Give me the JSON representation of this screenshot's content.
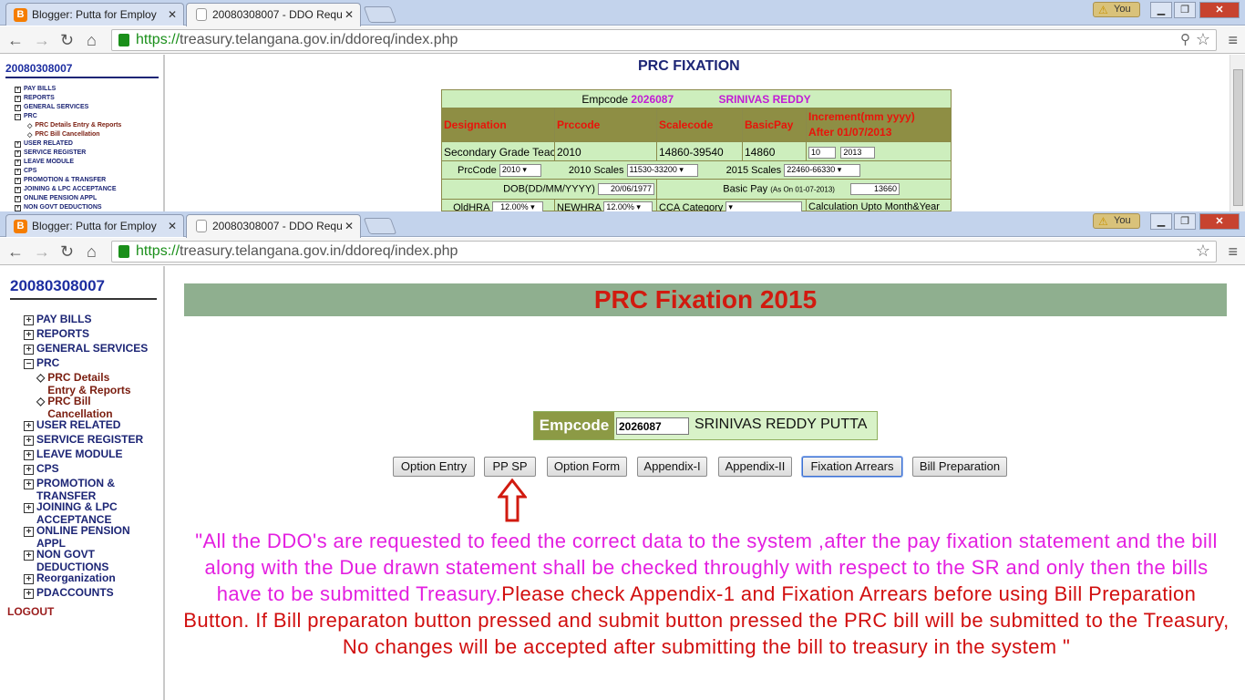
{
  "windows": [
    {
      "tabs": [
        {
          "label": "Blogger: Putta for Employ",
          "icon": "blogger-icon",
          "active": false
        },
        {
          "label": "20080308007 - DDO Requ",
          "icon": "page-icon",
          "active": true
        }
      ],
      "profile_badge": "You",
      "url_scheme": "https://",
      "url_rest": "treasury.telangana.gov.in/ddoreq/index.php",
      "sidebar": {
        "ddo_code": "20080308007",
        "items": [
          {
            "label": "PAY BILLS"
          },
          {
            "label": "REPORTS"
          },
          {
            "label": "GENERAL SERVICES"
          },
          {
            "label": "PRC"
          },
          {
            "label": "PRC Details Entry & Reports"
          },
          {
            "label": "PRC Bill Cancellation"
          },
          {
            "label": "USER RELATED"
          },
          {
            "label": "SERVICE REGISTER"
          },
          {
            "label": "LEAVE MODULE"
          },
          {
            "label": "CPS"
          },
          {
            "label": "PROMOTION & TRANSFER"
          },
          {
            "label": "JOINING & LPC ACCEPTANCE"
          },
          {
            "label": "ONLINE PENSION APPL"
          },
          {
            "label": "NON GOVT DEDUCTIONS"
          }
        ]
      },
      "main": {
        "title": "PRC FIXATION",
        "empcode_label": "Empcode",
        "empcode_value": "2026087",
        "emp_name": "SRINIVAS REDDY",
        "headers": {
          "designation": "Designation",
          "prccode": "Prccode",
          "scalecode": "Scalecode",
          "basicpay": "BasicPay",
          "increment_1": "Increment(mm yyyy)",
          "increment_2": "After 01/07/2013"
        },
        "row": {
          "designation": "Secondary Grade Teac",
          "prccode": "2010",
          "scalecode": "14860-39540",
          "basicpay": "14860",
          "inc_month": "10",
          "inc_year": "2013"
        },
        "scales": {
          "prccode_label": "PrcCode",
          "prccode_value": "2010",
          "scales2010_label": "2010 Scales",
          "scales2010_value": "11530-33200",
          "scales2015_label": "2015 Scales",
          "scales2015_value": "22460-66330"
        },
        "dob_label": "DOB(DD/MM/YYYY)",
        "dob_value": "20/06/1977",
        "basicpay_label": "Basic Pay",
        "basicpay_note": "(As On 01-07-2013)",
        "basicpay_value": "13660",
        "oldhra_label": "OldHRA",
        "oldhra_value": "12.00%",
        "newhra_label": "NEWHRA",
        "newhra_value": "12.00%",
        "cca_label": "CCA Category",
        "calc_label": "Calculation Upto Month&Year"
      }
    },
    {
      "tabs": [
        {
          "label": "Blogger: Putta for Employ",
          "icon": "blogger-icon",
          "active": false
        },
        {
          "label": "20080308007 - DDO Requ",
          "icon": "page-icon",
          "active": true
        }
      ],
      "profile_badge": "You",
      "url_scheme": "https://",
      "url_rest": "treasury.telangana.gov.in/ddoreq/index.php",
      "sidebar": {
        "ddo_code": "20080308007",
        "items": [
          {
            "label": "PAY BILLS"
          },
          {
            "label": "REPORTS"
          },
          {
            "label": "GENERAL SERVICES"
          },
          {
            "label": "PRC"
          },
          {
            "label": "PRC Details",
            "label2": "Entry & Reports"
          },
          {
            "label": "PRC Bill",
            "label2": "Cancellation"
          },
          {
            "label": "USER RELATED"
          },
          {
            "label": "SERVICE REGISTER"
          },
          {
            "label": "LEAVE MODULE"
          },
          {
            "label": "CPS"
          },
          {
            "label": "PROMOTION &",
            "label2": "TRANSFER"
          },
          {
            "label": "JOINING & LPC",
            "label2": "ACCEPTANCE"
          },
          {
            "label": "ONLINE PENSION",
            "label2": "APPL"
          },
          {
            "label": "NON GOVT",
            "label2": "DEDUCTIONS"
          },
          {
            "label": "Reorganization"
          },
          {
            "label": "PDACCOUNTS"
          }
        ],
        "logout": "LOGOUT"
      },
      "main": {
        "title": "PRC Fixation 2015",
        "empcode_label": "Empcode",
        "empcode_value": "2026087",
        "emp_name": "SRINIVAS REDDY PUTTA",
        "buttons": [
          "Option Entry",
          "PP SP",
          "Option Form",
          "Appendix-I",
          "Appendix-II",
          "Fixation Arrears",
          "Bill Preparation"
        ],
        "notice_magenta": "\"All the DDO's are requested to feed the correct data to the system ,after the pay fixation statement and the bill along with the Due drawn statement shall be checked throughly with respect to the SR and only then the bills have to be submitted Treasury.",
        "notice_red": "Please check Appendix-1 and Fixation Arrears before using Bill Preparation Button. If Bill preparaton button pressed and submit button pressed the PRC bill will be submitted to the Treasury, No changes will be accepted after submitting the bill to treasury in the system \""
      }
    }
  ],
  "colors": {
    "banner_bg": "#8faf8f",
    "title_red": "#d11a0f",
    "notice_magenta": "#e31fe0",
    "notice_red": "#d10f0f",
    "nav_blue": "#1c2575"
  }
}
